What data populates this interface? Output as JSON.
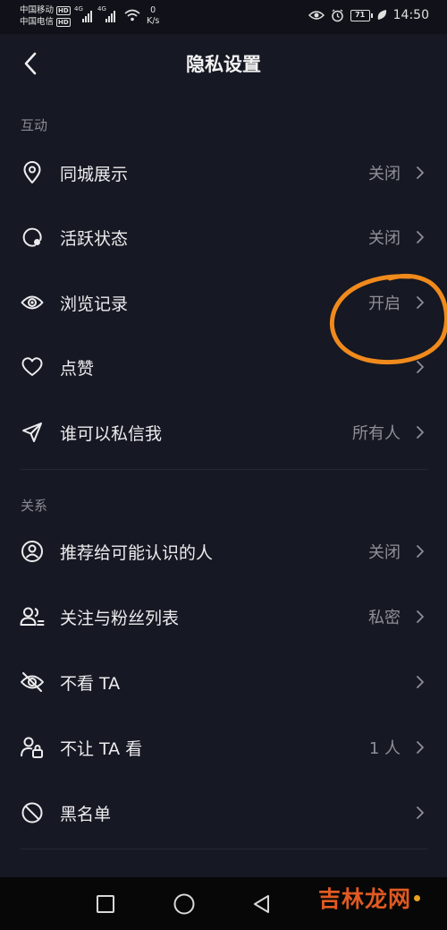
{
  "status_bar": {
    "carrier_1": "中国移动",
    "carrier_2": "中国电信",
    "hd_1": "HD",
    "hd_2": "HD",
    "net_1": "4G",
    "net_2": "4G",
    "speed_value": "0",
    "speed_unit": "K/s",
    "battery": "71",
    "time": "14:50"
  },
  "header": {
    "title": "隐私设置"
  },
  "sections": [
    {
      "label": "互动",
      "items": [
        {
          "icon": "location-pin-icon",
          "label": "同城展示",
          "value": "关闭"
        },
        {
          "icon": "activity-status-icon",
          "label": "活跃状态",
          "value": "关闭"
        },
        {
          "icon": "eye-icon",
          "label": "浏览记录",
          "value": "开启"
        },
        {
          "icon": "heart-icon",
          "label": "点赞",
          "value": ""
        },
        {
          "icon": "send-message-icon",
          "label": "谁可以私信我",
          "value": "所有人"
        }
      ]
    },
    {
      "label": "关系",
      "items": [
        {
          "icon": "user-circle-icon",
          "label": "推荐给可能认识的人",
          "value": "关闭"
        },
        {
          "icon": "users-list-icon",
          "label": "关注与粉丝列表",
          "value": "私密"
        },
        {
          "icon": "eye-off-icon",
          "label": "不看 TA",
          "value": ""
        },
        {
          "icon": "user-lock-icon",
          "label": "不让 TA 看",
          "value": "1 人"
        },
        {
          "icon": "block-icon",
          "label": "黑名单",
          "value": ""
        }
      ]
    }
  ],
  "watermark": "吉林龙网",
  "colors": {
    "background": "#161823",
    "annotation": "#f08a1c",
    "watermark": "#e05a23"
  }
}
